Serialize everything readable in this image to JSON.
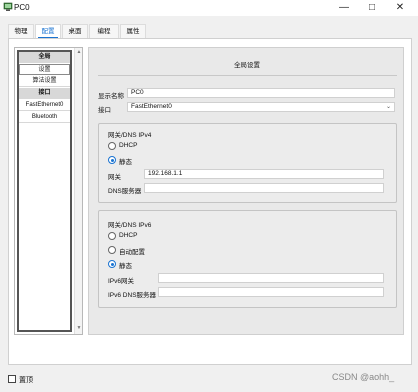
{
  "window": {
    "title": "PC0",
    "min_symbol": "—",
    "max_symbol": "□",
    "close_symbol": "✕"
  },
  "tabs": [
    {
      "label": "物理"
    },
    {
      "label": "配置",
      "active": true
    },
    {
      "label": "桌面"
    },
    {
      "label": "编程"
    },
    {
      "label": "属性"
    }
  ],
  "sidebar": {
    "items": [
      {
        "label": "全局",
        "kind": "header"
      },
      {
        "label": "设置",
        "kind": "selected"
      },
      {
        "label": "算法设置",
        "kind": "item"
      },
      {
        "label": "接口",
        "kind": "header"
      },
      {
        "label": "FastEthernet0",
        "kind": "item"
      },
      {
        "label": "Bluetooth",
        "kind": "item"
      }
    ],
    "scroll_up": "▲",
    "scroll_down": "▼"
  },
  "content": {
    "title": "全局设置",
    "display_name_label": "显示名称",
    "display_name_value": "PC0",
    "interface_label": "接口",
    "interface_value": "FastEthernet0",
    "ipv4": {
      "group_title": "网关/DNS IPv4",
      "dhcp_label": "DHCP",
      "static_label": "静态",
      "selected": "static",
      "gateway_label": "网关",
      "gateway_value": "192.168.1.1",
      "dns_label": "DNS服务器",
      "dns_value": ""
    },
    "ipv6": {
      "group_title": "网关/DNS IPv6",
      "dhcp_label": "DHCP",
      "auto_label": "自动配置",
      "static_label": "静态",
      "selected": "static",
      "gateway_label": "IPv6网关",
      "gateway_value": "",
      "dns_label": "IPv6 DNS服务器",
      "dns_value": ""
    }
  },
  "footer": {
    "checkbox_label": "置顶",
    "checked": false
  },
  "watermark": "CSDN @aohh_",
  "colors": {
    "accent": "#1a73d1"
  }
}
